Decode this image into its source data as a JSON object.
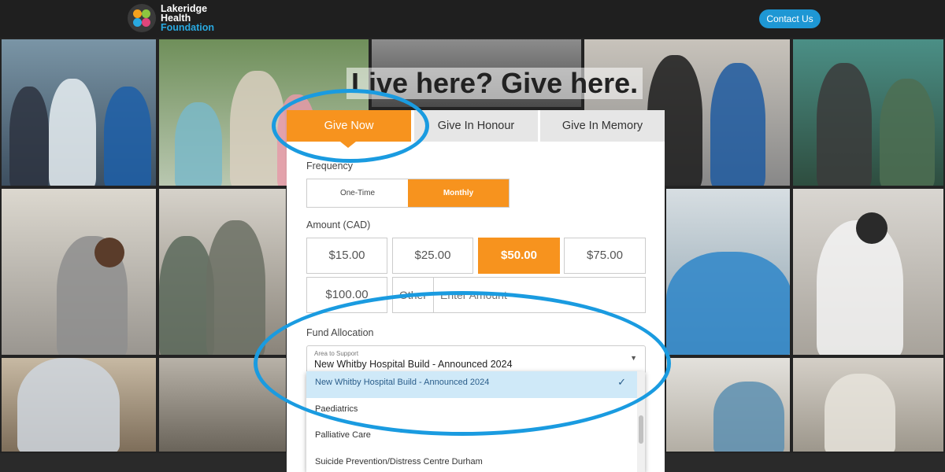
{
  "header": {
    "logo_line1": "Lakeridge",
    "logo_line2": "Health",
    "logo_line3": "Foundation",
    "contact_label": "Contact Us"
  },
  "hero": {
    "headline": "Live here? Give here."
  },
  "tabs": [
    {
      "label": "Give Now",
      "active": true
    },
    {
      "label": "Give In Honour",
      "active": false
    },
    {
      "label": "Give In Memory",
      "active": false
    }
  ],
  "frequency": {
    "label": "Frequency",
    "options": [
      "One-Time",
      "Monthly"
    ],
    "selected": "Monthly"
  },
  "amount": {
    "label": "Amount (CAD)",
    "options": [
      "$15.00",
      "$25.00",
      "$50.00",
      "$75.00",
      "$100.00"
    ],
    "selected": "$50.00",
    "other_label": "Other",
    "other_placeholder": "Enter Amount"
  },
  "fund": {
    "label": "Fund Allocation",
    "field_label": "Area to Support",
    "selected_value": "New Whitby Hospital Build - Announced 2024",
    "options": [
      "New Whitby Hospital Build - Announced 2024",
      "Paediatrics",
      "Palliative Care",
      "Suicide Prevention/Distress Centre Durham"
    ]
  },
  "colors": {
    "accent_orange": "#f7931e",
    "highlight_blue": "#1a9be0",
    "contact_blue": "#1e97d4"
  },
  "icons": {
    "dropdown_arrow": "▼",
    "check": "✓"
  }
}
